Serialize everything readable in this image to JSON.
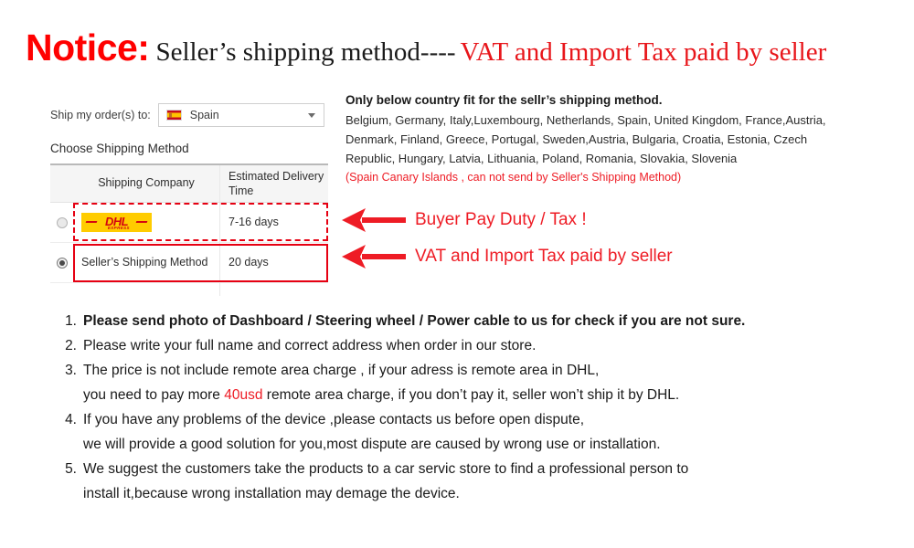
{
  "title": {
    "notice": "Notice:",
    "middle": "Seller’s  shipping method----",
    "red": "VAT and Import Tax paid by seller"
  },
  "shipping_widget": {
    "ship_to_label": "Ship my order(s) to:",
    "country_value": "Spain",
    "country_flag_icon": "spain-flag-icon",
    "dropdown_icon": "chevron-down-icon",
    "choose_label": "Choose Shipping Method",
    "table": {
      "headers": [
        "Shipping Company",
        "Estimated Delivery Time"
      ],
      "rows": [
        {
          "selected": false,
          "company_type": "logo",
          "company_logo": "dhl-express-logo",
          "company_logo_text": "DHL",
          "company_logo_sub": "EXPRESS",
          "time": "7-16 days",
          "highlight": "dashed"
        },
        {
          "selected": true,
          "company_type": "text",
          "company": "Seller’s Shipping Method",
          "time": "20 days",
          "highlight": "solid"
        }
      ]
    }
  },
  "right_text": {
    "heading": "Only below country fit for the sellr’s shipping method.",
    "countries_lines": [
      "Belgium, Germany, Italy,Luxembourg, Netherlands, Spain, United Kingdom, France,Austria,",
      "Denmark, Finland, Greece, Portugal, Sweden,Austria, Bulgaria, Croatia, Estonia, Czech",
      "Republic, Hungary, Latvia, Lithuania, Poland, Romania, Slovakia, Slovenia"
    ],
    "note_red": "(Spain Canary Islands , can not send by  Seller's Shipping Method)"
  },
  "annotations": [
    {
      "icon": "left-arrow-icon",
      "text": "Buyer Pay Duty / Tax !"
    },
    {
      "icon": "left-arrow-icon",
      "text": "VAT and Import Tax paid by seller"
    }
  ],
  "notes": [
    {
      "number": "1.",
      "bold": true,
      "lines": [
        "Please send photo of Dashboard / Steering wheel / Power cable to us for check if you are not sure."
      ]
    },
    {
      "number": "2.",
      "bold": false,
      "lines": [
        "Please write your full name and correct address when order in our store."
      ]
    },
    {
      "number": "3.",
      "bold": false,
      "lines": [
        "The price is not include remote area charge , if your adress is remote area in DHL,"
      ],
      "line2_pre": "you need to pay more ",
      "line2_red": "40usd",
      "line2_post": " remote area charge, if you don’t pay it, seller won’t ship it by DHL."
    },
    {
      "number": "4.",
      "bold": false,
      "lines": [
        "If you have any problems of the device ,please contacts us before open dispute,",
        "we will provide a good solution for you,most dispute are caused by wrong use or installation."
      ]
    },
    {
      "number": "5.",
      "bold": false,
      "lines": [
        "We suggest the customers take the products to a car servic store to find a professional person to",
        "install it,because wrong installation may demage the device."
      ]
    }
  ],
  "colors": {
    "red": "#ee1c25",
    "notice_red": "#ff0000",
    "dhl_yellow": "#ffcc00",
    "dhl_red": "#d40511",
    "highlight_red": "#e60012"
  }
}
